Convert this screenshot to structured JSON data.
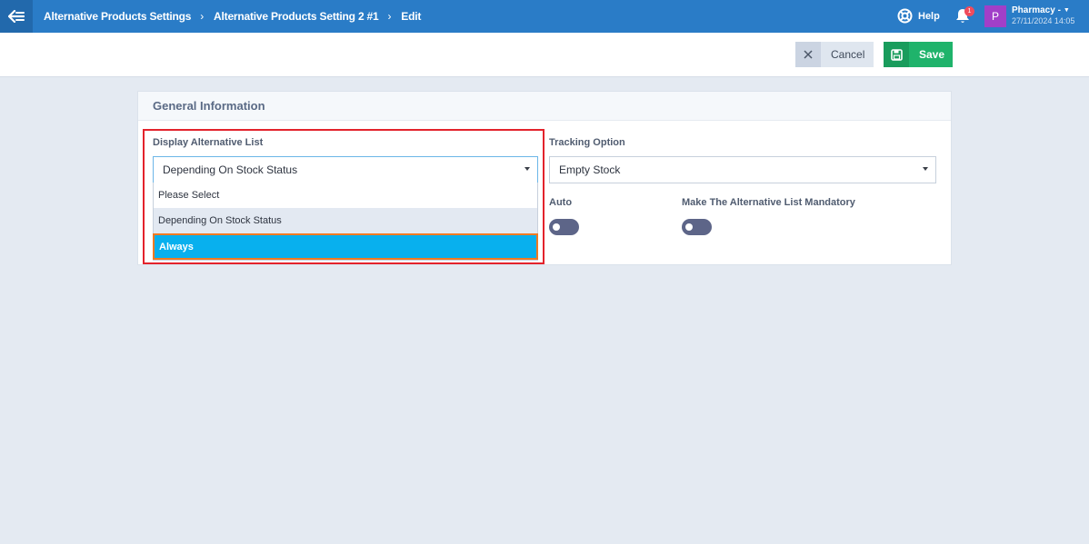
{
  "topbar": {
    "breadcrumb": [
      "Alternative Products Settings",
      "Alternative Products Setting 2 #1",
      "Edit"
    ],
    "help_label": "Help",
    "notification_count": "1",
    "user_initial": "P",
    "user_name": "Pharmacy -",
    "user_date": "27/11/2024 14:05"
  },
  "actions": {
    "cancel_label": "Cancel",
    "save_label": "Save"
  },
  "card": {
    "title": "General Information",
    "display_list": {
      "label": "Display Alternative List",
      "value": "Depending On Stock Status",
      "options": [
        "Please Select",
        "Depending On Stock Status",
        "Always"
      ],
      "hovered_option": "Depending On Stock Status",
      "highlighted_option": "Always"
    },
    "tracking": {
      "label": "Tracking Option",
      "value": "Empty Stock"
    },
    "auto": {
      "label": "Auto",
      "enabled": false
    },
    "mandatory": {
      "label": "Make The Alternative List Mandatory",
      "enabled": false
    }
  },
  "colors": {
    "topbar": "#2a7cc7",
    "save": "#1fb36b",
    "highlight_border": "#e3232c",
    "selected_option": "#08b0ee"
  }
}
